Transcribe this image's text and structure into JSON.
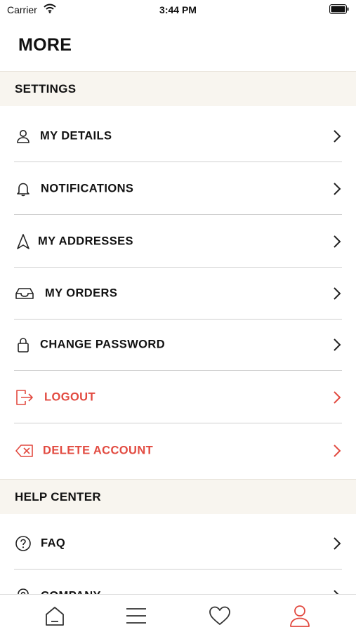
{
  "status": {
    "carrier": "Carrier",
    "time": "3:44 PM"
  },
  "title": "MORE",
  "settings": {
    "header": "SETTINGS",
    "items": [
      {
        "label": "MY DETAILS",
        "icon": "person-icon"
      },
      {
        "label": "NOTIFICATIONS",
        "icon": "bell-icon"
      },
      {
        "label": "MY ADDRESSES",
        "icon": "navigation-arrow-icon"
      },
      {
        "label": "MY ORDERS",
        "icon": "inbox-tray-icon"
      },
      {
        "label": "CHANGE PASSWORD",
        "icon": "lock-icon"
      },
      {
        "label": "LOGOUT",
        "icon": "logout-icon"
      },
      {
        "label": "DELETE ACCOUNT",
        "icon": "delete-key-icon"
      }
    ]
  },
  "help": {
    "header": "HELP CENTER",
    "items": [
      {
        "label": "FAQ",
        "icon": "question-circle-icon"
      },
      {
        "label": "COMPANY",
        "icon": "location-pin-icon"
      }
    ]
  },
  "tabs": [
    "home-icon",
    "menu-icon",
    "heart-icon",
    "profile-icon"
  ],
  "colors": {
    "danger": "#e24a40",
    "section_bg": "#f8f5ef",
    "active_tab": "#e24a40"
  }
}
